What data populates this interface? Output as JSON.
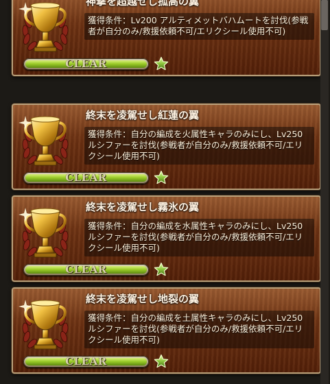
{
  "achievements": [
    {
      "title": "神撃を超越せし孤高の翼",
      "condition": "獲得条件：Lv200 アルティメットバハムートを討伐(参戦者が自分のみ/救援依頼不可/エリクシール使用不可)",
      "status_label": "CLEAR",
      "progress": 1.0,
      "icon": "gold-trophy-icon"
    },
    {
      "title": "終末を凌駕せし紅蓮の翼",
      "condition": "獲得条件：自分の編成を火属性キャラのみにし、Lv250 ルシファーを討伐(参戦者が自分のみ/救援依頼不可/エリクシール使用不可)",
      "status_label": "CLEAR",
      "progress": 1.0,
      "icon": "gold-trophy-icon"
    },
    {
      "title": "終末を凌駕せし霧氷の翼",
      "condition": "獲得条件：自分の編成を水属性キャラのみにし、Lv250 ルシファーを討伐(参戦者が自分のみ/救援依頼不可/エリクシール使用不可)",
      "status_label": "CLEAR",
      "progress": 1.0,
      "icon": "gold-trophy-icon"
    },
    {
      "title": "終末を凌駕せし地裂の翼",
      "condition": "獲得条件：自分の編成を土属性キャラのみにし、Lv250 ルシファーを討伐(参戦者が自分のみ/救援依頼不可/エリクシール使用不可)",
      "status_label": "CLEAR",
      "progress": 1.0,
      "icon": "gold-trophy-icon"
    }
  ],
  "colors": {
    "card_bg": "#6a3012",
    "progress_green": "#9ccc2a",
    "star_green": "#8ec63f"
  }
}
